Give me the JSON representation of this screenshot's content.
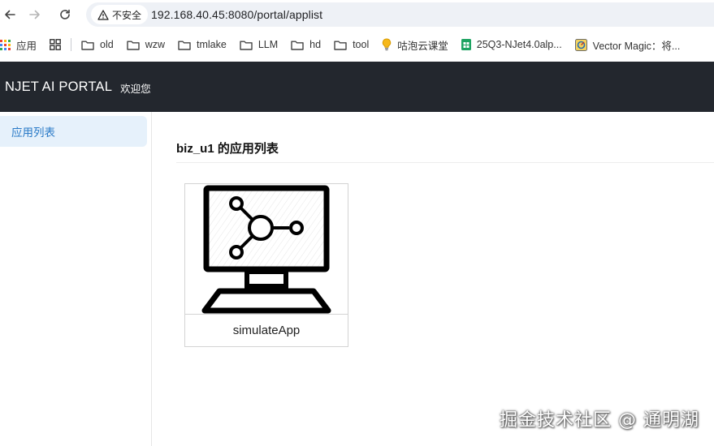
{
  "browser": {
    "security_label": "不安全",
    "url": "192.168.40.45:8080/portal/applist",
    "icons": [
      "back-icon",
      "forward-icon",
      "reload-icon",
      "warning-icon"
    ]
  },
  "bookmarks": [
    {
      "label": "应用",
      "icon": "apps-grid-icon"
    },
    {
      "label": "",
      "icon": "tab-groups-icon"
    },
    {
      "label": "old",
      "icon": "folder-icon"
    },
    {
      "label": "wzw",
      "icon": "folder-icon"
    },
    {
      "label": "tmlake",
      "icon": "folder-icon"
    },
    {
      "label": "LLM",
      "icon": "folder-icon"
    },
    {
      "label": "hd",
      "icon": "folder-icon"
    },
    {
      "label": "tool",
      "icon": "folder-icon"
    },
    {
      "label": "咕泡云课堂",
      "icon": "lightbulb-icon"
    },
    {
      "label": "25Q3-NJet4.0alp...",
      "icon": "sheets-icon"
    },
    {
      "label": "Vector Magic：将...",
      "icon": "vector-magic-icon"
    }
  ],
  "header": {
    "title": "NJET AI PORTAL",
    "welcome": "欢迎您"
  },
  "sidebar": {
    "items": [
      {
        "label": "应用列表",
        "active": true
      }
    ]
  },
  "main": {
    "title": "biz_u1 的应用列表",
    "apps": [
      {
        "name": "simulateApp",
        "icon": "monitor-network-icon"
      }
    ]
  },
  "watermark": "掘金技术社区 @ 通明湖",
  "colors": {
    "header_bg": "#23272e",
    "sidebar_active_bg": "#e6f1fb",
    "sidebar_active_text": "#2a7ac7"
  }
}
